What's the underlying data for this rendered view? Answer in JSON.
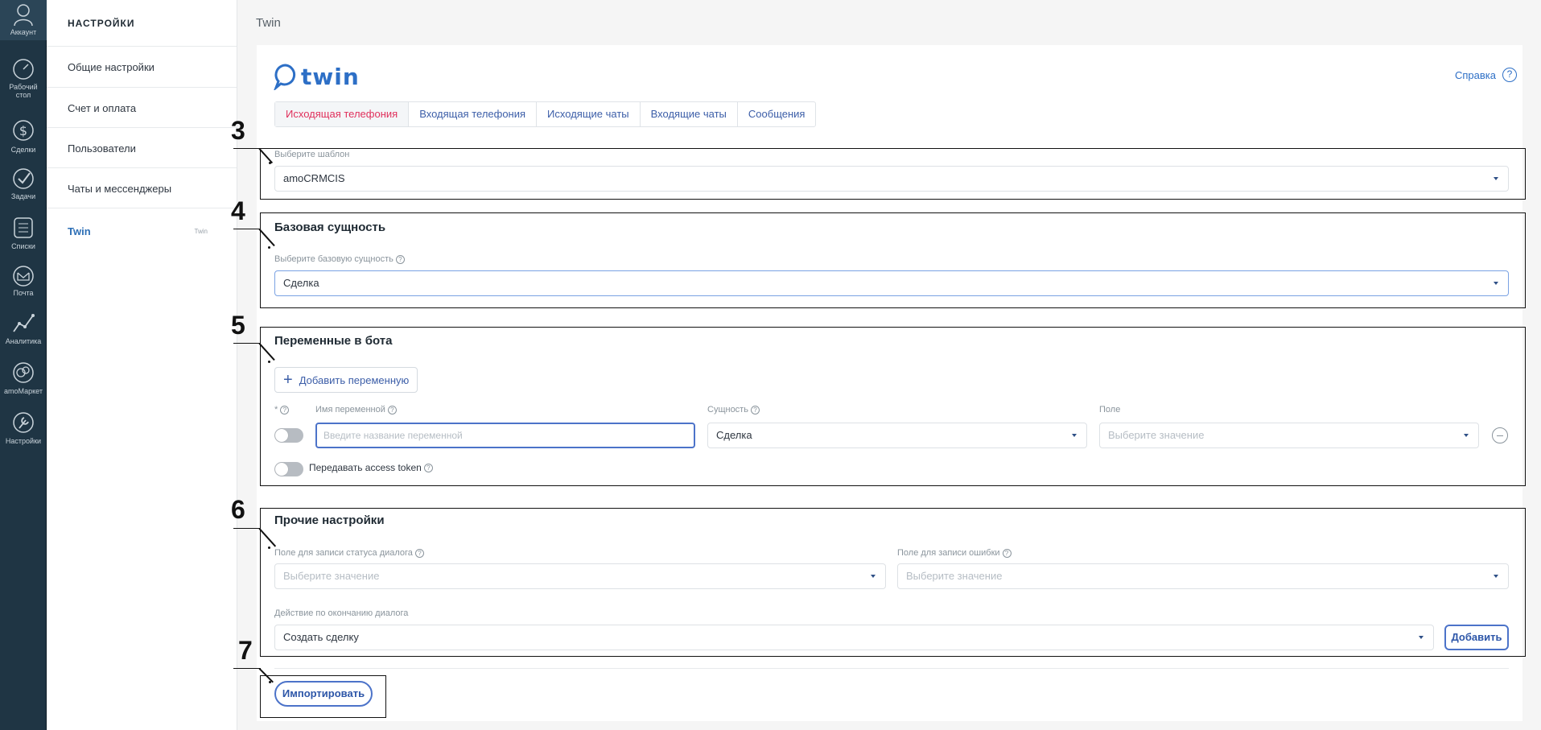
{
  "rail": [
    {
      "label": "Аккаунт",
      "icon": "user-icon"
    },
    {
      "label": "Рабочий стол",
      "icon": "dashboard-icon"
    },
    {
      "label": "Сделки",
      "icon": "dollar-icon"
    },
    {
      "label": "Задачи",
      "icon": "check-icon"
    },
    {
      "label": "Списки",
      "icon": "list-icon"
    },
    {
      "label": "Почта",
      "icon": "mail-icon"
    },
    {
      "label": "Аналитика",
      "icon": "analytics-icon"
    },
    {
      "label": "amoМаркет",
      "icon": "market-icon"
    },
    {
      "label": "Настройки",
      "icon": "wrench-icon"
    }
  ],
  "sidebar": {
    "title": "НАСТРОЙКИ",
    "items": [
      "Общие настройки",
      "Счет и оплата",
      "Пользователи",
      "Чаты и мессенджеры"
    ],
    "active": {
      "label": "Twin",
      "sub": "Twin"
    }
  },
  "page": {
    "title": "Twin",
    "logo_text": "twin",
    "help_label": "Справка",
    "help_icon": "question-icon"
  },
  "tabs": [
    "Исходящая телефония",
    "Входящая телефония",
    "Исходящие чаты",
    "Входящие чаты",
    "Сообщения"
  ],
  "template": {
    "label": "Выберите шаблон",
    "value": "amoCRMCIS"
  },
  "base": {
    "title": "Базовая сущность",
    "label": "Выберите базовую сущность",
    "value": "Сделка"
  },
  "vars": {
    "title": "Переменные в бота",
    "add_label": "Добавить переменную",
    "col_required": "*",
    "col_name": "Имя переменной",
    "col_entity": "Сущность",
    "col_field": "Поле",
    "name_placeholder": "Введите название переменной",
    "entity_value": "Сделка",
    "field_placeholder": "Выберите значение",
    "access_token_label": "Передавать access token"
  },
  "other": {
    "title": "Прочие настройки",
    "status_label": "Поле для записи статуса диалога",
    "status_placeholder": "Выберите значение",
    "error_label": "Поле для записи ошибки",
    "error_placeholder": "Выберите значение",
    "action_label": "Действие по окончанию диалога",
    "action_value": "Создать сделку",
    "add_button": "Добавить"
  },
  "import_button": "Импортировать",
  "annotations": [
    "3",
    "4",
    "5",
    "6",
    "7"
  ],
  "colors": {
    "accent": "#2d6fc6",
    "active_tab": "#e0305c",
    "rail_bg": "#1f3544"
  }
}
